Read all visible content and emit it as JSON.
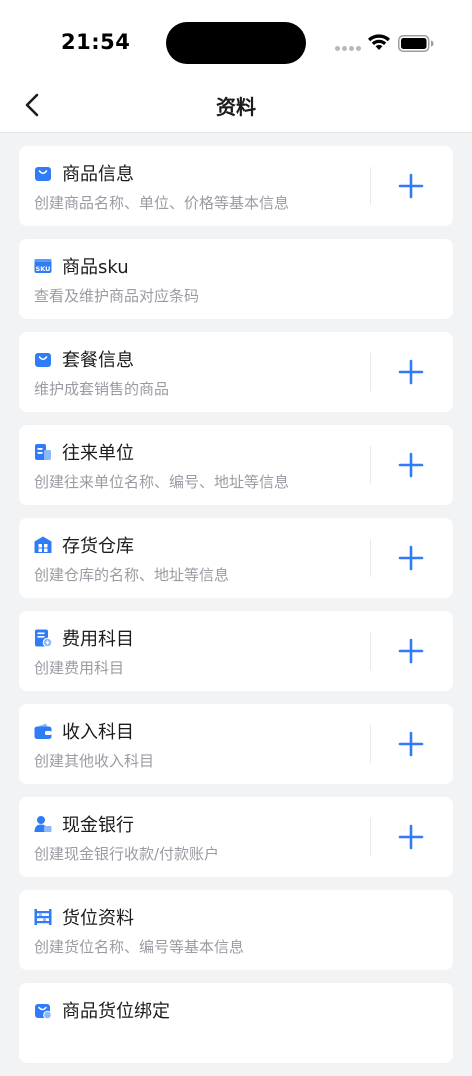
{
  "status_bar": {
    "time": "21:54"
  },
  "nav": {
    "title": "资料"
  },
  "colors": {
    "accent": "#2f7cf6",
    "title_text": "#1c1c1e",
    "desc_text": "#9a9ca3",
    "background": "#f2f3f5"
  },
  "items": [
    {
      "title": "商品信息",
      "desc": "创建商品名称、单位、价格等基本信息",
      "icon": "shopping-bag-icon",
      "has_add": true
    },
    {
      "title": "商品sku",
      "desc": "查看及维护商品对应条码",
      "icon": "sku-icon",
      "has_add": false
    },
    {
      "title": "套餐信息",
      "desc": "维护成套销售的商品",
      "icon": "package-bag-icon",
      "has_add": true
    },
    {
      "title": "往来单位",
      "desc": "创建往来单位名称、编号、地址等信息",
      "icon": "contact-unit-icon",
      "has_add": true
    },
    {
      "title": "存货仓库",
      "desc": "创建仓库的名称、地址等信息",
      "icon": "warehouse-icon",
      "has_add": true
    },
    {
      "title": "费用科目",
      "desc": "创建费用科目",
      "icon": "expense-icon",
      "has_add": true
    },
    {
      "title": "收入科目",
      "desc": "创建其他收入科目",
      "icon": "wallet-icon",
      "has_add": true
    },
    {
      "title": "现金银行",
      "desc": "创建现金银行收款/付款账户",
      "icon": "bank-account-icon",
      "has_add": true
    },
    {
      "title": "货位资料",
      "desc": "创建货位名称、编号等基本信息",
      "icon": "shelf-icon",
      "has_add": false
    },
    {
      "title": "商品货位绑定",
      "desc": "",
      "icon": "bag-link-icon",
      "has_add": false
    }
  ]
}
